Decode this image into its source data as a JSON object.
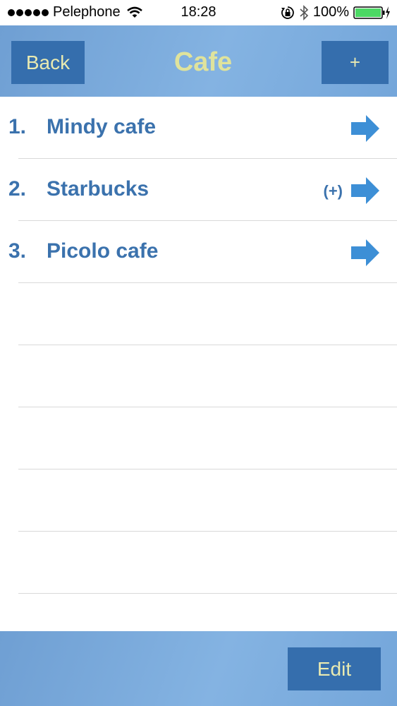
{
  "status_bar": {
    "carrier": "Pelephone",
    "time": "18:28",
    "battery": "100%",
    "icons": [
      "signal-icon",
      "wifi-icon",
      "rotation-lock-icon",
      "bluetooth-icon",
      "battery-icon",
      "charging-icon"
    ]
  },
  "navbar": {
    "back_label": "Back",
    "title": "Cafe",
    "add_label": "+"
  },
  "list": {
    "items": [
      {
        "number": "1.",
        "label": "Mindy cafe",
        "badge": ""
      },
      {
        "number": "2.",
        "label": "Starbucks",
        "badge": "(+)"
      },
      {
        "number": "3.",
        "label": "Picolo cafe",
        "badge": ""
      }
    ],
    "empty_rows": 6
  },
  "bottom_bar": {
    "edit_label": "Edit"
  },
  "colors": {
    "bar_blue": "#7bacde",
    "button_blue": "#356ead",
    "button_text": "#e9eab1",
    "title_text": "#dfe39c",
    "item_text": "#3b72ad",
    "arrow": "#3d8fd6",
    "battery_green": "#4cd964"
  }
}
